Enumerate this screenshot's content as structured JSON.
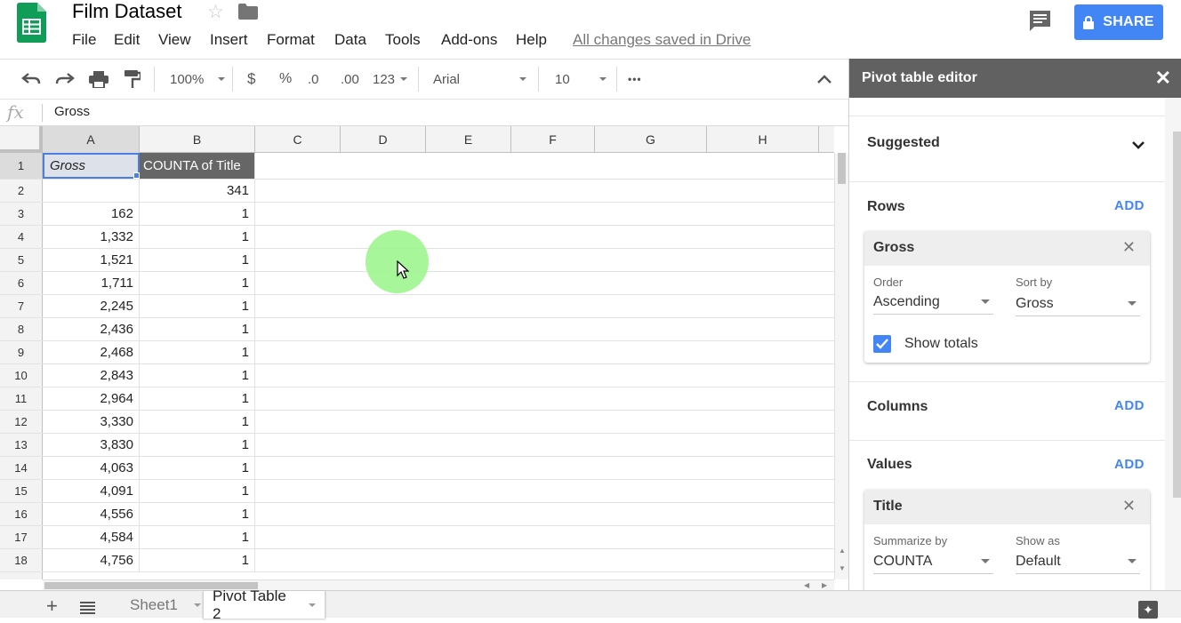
{
  "app": {
    "title": "Film Dataset",
    "save_status": "All changes saved in Drive",
    "share_label": "SHARE"
  },
  "menu": [
    "File",
    "Edit",
    "View",
    "Insert",
    "Format",
    "Data",
    "Tools",
    "Add-ons",
    "Help"
  ],
  "toolbar": {
    "zoom": "100%",
    "currency": "$",
    "percent": "%",
    "decrease_decimal": ".0",
    "increase_decimal": ".00",
    "more_formats": "123",
    "font": "Arial",
    "font_size": "10",
    "more": "•••"
  },
  "formula_bar": {
    "fx": "fx",
    "value": "Gross"
  },
  "grid": {
    "columns": [
      "A",
      "B",
      "C",
      "D",
      "E",
      "F",
      "G",
      "H"
    ],
    "header_row": {
      "a": "Gross",
      "b": "COUNTA of Title"
    },
    "rows": [
      {
        "n": "1",
        "a": "",
        "b": ""
      },
      {
        "n": "2",
        "a": "",
        "b": "341"
      },
      {
        "n": "3",
        "a": "162",
        "b": "1"
      },
      {
        "n": "4",
        "a": "1,332",
        "b": "1"
      },
      {
        "n": "5",
        "a": "1,521",
        "b": "1"
      },
      {
        "n": "6",
        "a": "1,711",
        "b": "1"
      },
      {
        "n": "7",
        "a": "2,245",
        "b": "1"
      },
      {
        "n": "8",
        "a": "2,436",
        "b": "1"
      },
      {
        "n": "9",
        "a": "2,468",
        "b": "1"
      },
      {
        "n": "10",
        "a": "2,843",
        "b": "1"
      },
      {
        "n": "11",
        "a": "2,964",
        "b": "1"
      },
      {
        "n": "12",
        "a": "3,330",
        "b": "1"
      },
      {
        "n": "13",
        "a": "3,830",
        "b": "1"
      },
      {
        "n": "14",
        "a": "4,063",
        "b": "1"
      },
      {
        "n": "15",
        "a": "4,091",
        "b": "1"
      },
      {
        "n": "16",
        "a": "4,556",
        "b": "1"
      },
      {
        "n": "17",
        "a": "4,584",
        "b": "1"
      },
      {
        "n": "18",
        "a": "4,756",
        "b": "1"
      }
    ]
  },
  "sheets": {
    "tab1": "Sheet1",
    "tab2": "Pivot Table 2",
    "active": "Pivot Table 2"
  },
  "pivot": {
    "title": "Pivot table editor",
    "suggested": "Suggested",
    "rows_label": "Rows",
    "columns_label": "Columns",
    "values_label": "Values",
    "add_label": "ADD",
    "row_field": {
      "name": "Gross",
      "order_label": "Order",
      "order_value": "Ascending",
      "sort_label": "Sort by",
      "sort_value": "Gross",
      "show_totals": "Show totals",
      "show_totals_checked": true
    },
    "value_field": {
      "name": "Title",
      "summarize_label": "Summarize by",
      "summarize_value": "COUNTA",
      "show_as_label": "Show as",
      "show_as_value": "Default"
    }
  },
  "colors": {
    "accent": "#4285f4",
    "sheets_green": "#0f9d58",
    "panel_header": "#616161",
    "cursor_highlight": "#9ef58f"
  }
}
